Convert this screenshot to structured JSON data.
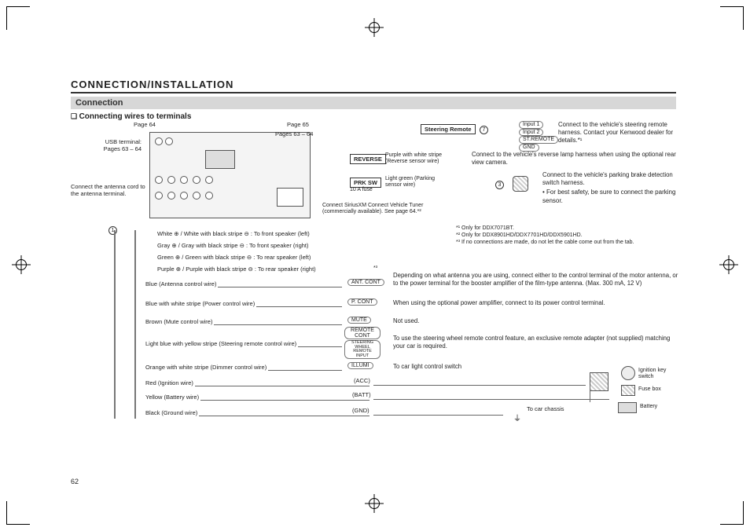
{
  "page_number": "62",
  "section_title": "CONNECTION/INSTALLATION",
  "subsection_title": "Connection",
  "subsubsection_title": "Connecting wires to terminals",
  "refs": {
    "page64": "Page 64",
    "page65": "Page 65",
    "pages63_64": "Pages 63 – 64",
    "pages63_64_b": "Pages 63 – 64",
    "usb_terminal": "USB terminal:"
  },
  "unit_labels": {
    "steering_remote": "Steering Remote",
    "reverse": "REVERSE",
    "prk_sw": "PRK SW",
    "fuse": "10 A fuse",
    "input1": "Input 1",
    "input2": "Input 2",
    "st_remote": "ST.REMOTE",
    "gnd_small": "GND"
  },
  "antenna_text": "Connect the antenna cord to the antenna terminal.",
  "reverse_wire": "Purple with white stripe (Reverse sensor wire)",
  "prk_wire": "Light green (Parking sensor wire)",
  "siriusxm": "Connect SiriusXM Connect Vehicle Tuner (commercially available). See page 64.*²",
  "right_notes": {
    "steering": "Connect to the vehicle's steering remote harness. Contact your Kenwood dealer for details.*¹",
    "reverse": "Connect to the vehicle's reverse lamp harness when using the optional rear view camera.",
    "parking": "Connect to the vehicle's parking brake detection switch harness.",
    "parking_bullet": "For best safety, be sure to connect the parking sensor."
  },
  "footnotes": {
    "f1": "*¹  Only for DDX7071BT.",
    "f2": "*²  Only for DDX8901HD/DDX7701HD/DDX5901HD.",
    "f3": "*³  If no connections are made, do not let the cable come out from the tab."
  },
  "speaker_wires": {
    "front_left": "White ⊕ / White with black stripe ⊖ : To front speaker (left)",
    "front_right": "Gray ⊕ / Gray with black stripe ⊖ : To front speaker (right)",
    "rear_left": "Green ⊕ / Green with black stripe ⊖ : To rear speaker (left)",
    "rear_right": "Purple ⊕ / Purple with black stripe ⊖ : To rear speaker (right)"
  },
  "ctrl_wires": {
    "ant_cont": {
      "wire": "Blue (Antenna control wire)",
      "tag": "ANT. CONT"
    },
    "p_cont": {
      "wire": "Blue with white stripe (Power control wire)",
      "tag": "P. CONT"
    },
    "mute": {
      "wire": "Brown (Mute control wire)",
      "tag": "MUTE"
    },
    "steering": {
      "wire": "Light blue with yellow stripe (Steering remote control wire)",
      "tag_a": "REMOTE CONT",
      "tag_b": "STEERING WHEEL REMOTE INPUT"
    },
    "illumi": {
      "wire": "Orange with white stripe (Dimmer control wire)",
      "tag": "ILLUMI"
    },
    "acc": {
      "wire": "Red (Ignition wire)",
      "tag": "(ACC)"
    },
    "batt": {
      "wire": "Yellow (Battery wire)",
      "tag": "(BATT)"
    },
    "gnd": {
      "wire": "Black (Ground wire)",
      "tag": "(GND)"
    }
  },
  "right_explanations": {
    "ant": "Depending on what antenna you are using, connect either to the control terminal of the motor antenna, or to the power terminal for the booster amplifier of the film-type antenna. (Max. 300 mA, 12 V)",
    "pcont": "When using the optional power amplifier, connect to its power control terminal.",
    "mute": "Not used.",
    "steering": "To use the steering wheel remote control feature, an exclusive remote adapter (not supplied) matching your car is required.",
    "illumi": "To car light control switch"
  },
  "bottom_right": {
    "chassis": "To car chassis",
    "ignition": "Ignition key switch",
    "fuse_box": "Fuse box",
    "battery": "Battery"
  },
  "footnote3_marker": "*³",
  "circled": {
    "one": "1",
    "three": "3",
    "seven": "7"
  }
}
